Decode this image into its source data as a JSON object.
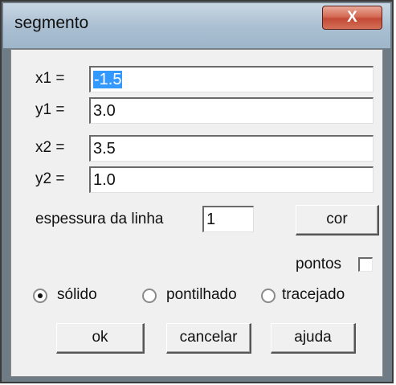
{
  "window": {
    "title": "segmento",
    "close_glyph": "X"
  },
  "fields": [
    {
      "label": "x1 =",
      "value": "-1.5"
    },
    {
      "label": "y1 =",
      "value": "3.0"
    },
    {
      "label": "x2 =",
      "value": "3.5"
    },
    {
      "label": "y2 =",
      "value": "1.0"
    }
  ],
  "thickness": {
    "label": "espessura da linha",
    "value": "1"
  },
  "color_button": "cor",
  "points": {
    "label": "pontos",
    "checked": false
  },
  "line_style": {
    "options": [
      "sólido",
      "pontilhado",
      "tracejado"
    ],
    "selected": "sólido"
  },
  "buttons": {
    "ok": "ok",
    "cancel": "cancelar",
    "help": "ajuda"
  }
}
